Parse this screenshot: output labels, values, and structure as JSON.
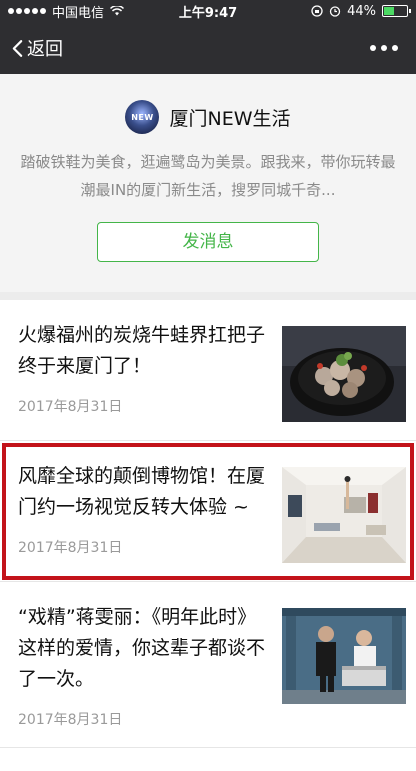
{
  "status_bar": {
    "carrier": "中国电信",
    "time": "上午9:47",
    "battery": "44%",
    "battery_level": 0.44
  },
  "nav": {
    "back_label": "返回"
  },
  "profile": {
    "avatar_text": "NEW",
    "name": "厦门NEW生活",
    "description": "踏破铁鞋为美食，逛遍鹭岛为美景。跟我来，带你玩转最潮最IN的厦门新生活，搜罗同城千奇...",
    "send_message": "发消息"
  },
  "articles": [
    {
      "title": "火爆福州的炭烧牛蛙界扛把子终于来厦门了！",
      "date": "2017年8月31日",
      "thumb": "food-image"
    },
    {
      "title": "风靡全球的颠倒博物馆！在厦门约一场视觉反转大体验 ~",
      "date": "2017年8月31日",
      "thumb": "room-image"
    },
    {
      "title": "“戏精”蒋雯丽：《明年此时》这样的爱情，你这辈子都谈不了一次。",
      "date": "2017年8月31日",
      "thumb": "stage-image"
    }
  ],
  "colors": {
    "header_bg": "#2e2e31",
    "accent_green": "#44b549",
    "highlight_red": "#c3131a"
  }
}
